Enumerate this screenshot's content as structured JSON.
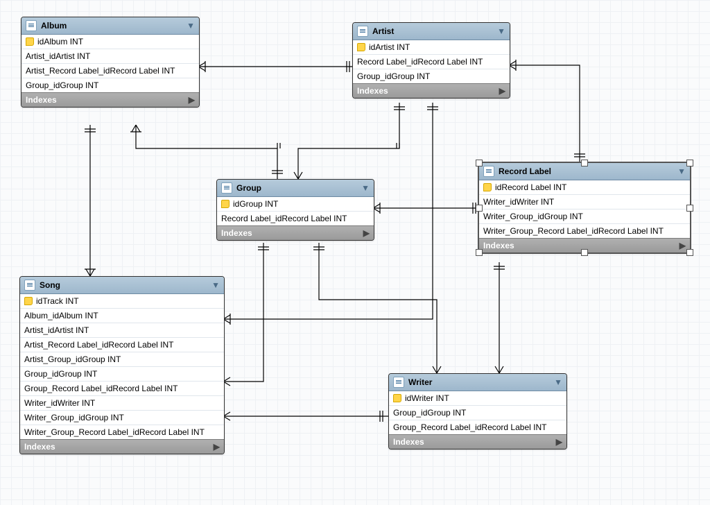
{
  "tables": {
    "album": {
      "title": "Album",
      "indexes": "Indexes",
      "fields": [
        {
          "name": "idAlbum INT",
          "pk": true
        },
        {
          "name": "Artist_idArtist INT",
          "pk": false
        },
        {
          "name": "Artist_Record Label_idRecord Label INT",
          "pk": false
        },
        {
          "name": "Group_idGroup INT",
          "pk": false
        }
      ]
    },
    "artist": {
      "title": "Artist",
      "indexes": "Indexes",
      "fields": [
        {
          "name": "idArtist INT",
          "pk": true
        },
        {
          "name": "Record Label_idRecord Label INT",
          "pk": false
        },
        {
          "name": "Group_idGroup INT",
          "pk": false
        }
      ]
    },
    "group": {
      "title": "Group",
      "indexes": "Indexes",
      "fields": [
        {
          "name": "idGroup INT",
          "pk": true
        },
        {
          "name": "Record Label_idRecord Label INT",
          "pk": false
        }
      ]
    },
    "recordlabel": {
      "title": "Record Label",
      "indexes": "Indexes",
      "fields": [
        {
          "name": "idRecord Label INT",
          "pk": true
        },
        {
          "name": "Writer_idWriter INT",
          "pk": false
        },
        {
          "name": "Writer_Group_idGroup INT",
          "pk": false
        },
        {
          "name": "Writer_Group_Record Label_idRecord Label INT",
          "pk": false
        }
      ]
    },
    "song": {
      "title": "Song",
      "indexes": "Indexes",
      "fields": [
        {
          "name": "idTrack INT",
          "pk": true
        },
        {
          "name": "Album_idAlbum INT",
          "pk": false
        },
        {
          "name": "Artist_idArtist INT",
          "pk": false
        },
        {
          "name": "Artist_Record Label_idRecord Label INT",
          "pk": false
        },
        {
          "name": "Artist_Group_idGroup INT",
          "pk": false
        },
        {
          "name": "Group_idGroup INT",
          "pk": false
        },
        {
          "name": "Group_Record Label_idRecord Label INT",
          "pk": false
        },
        {
          "name": "Writer_idWriter INT",
          "pk": false
        },
        {
          "name": "Writer_Group_idGroup INT",
          "pk": false
        },
        {
          "name": "Writer_Group_Record Label_idRecord Label INT",
          "pk": false
        }
      ]
    },
    "writer": {
      "title": "Writer",
      "indexes": "Indexes",
      "fields": [
        {
          "name": "idWriter INT",
          "pk": true
        },
        {
          "name": "Group_idGroup INT",
          "pk": false
        },
        {
          "name": "Group_Record Label_idRecord Label INT",
          "pk": false
        }
      ]
    }
  },
  "chart_data": {
    "type": "er-diagram",
    "entities": [
      "Album",
      "Artist",
      "Group",
      "Record Label",
      "Song",
      "Writer"
    ],
    "relationships": [
      {
        "from": "Album",
        "to": "Artist",
        "type": "many-to-one"
      },
      {
        "from": "Album",
        "to": "Group",
        "type": "many-to-one"
      },
      {
        "from": "Album",
        "to": "Song",
        "type": "one-to-many"
      },
      {
        "from": "Artist",
        "to": "Record Label",
        "type": "many-to-one"
      },
      {
        "from": "Artist",
        "to": "Group",
        "type": "many-to-one"
      },
      {
        "from": "Artist",
        "to": "Song",
        "type": "one-to-many"
      },
      {
        "from": "Group",
        "to": "Record Label",
        "type": "many-to-one"
      },
      {
        "from": "Group",
        "to": "Song",
        "type": "one-to-many"
      },
      {
        "from": "Group",
        "to": "Writer",
        "type": "one-to-many"
      },
      {
        "from": "Writer",
        "to": "Record Label",
        "type": "one-to-many"
      },
      {
        "from": "Writer",
        "to": "Song",
        "type": "one-to-many"
      }
    ]
  }
}
